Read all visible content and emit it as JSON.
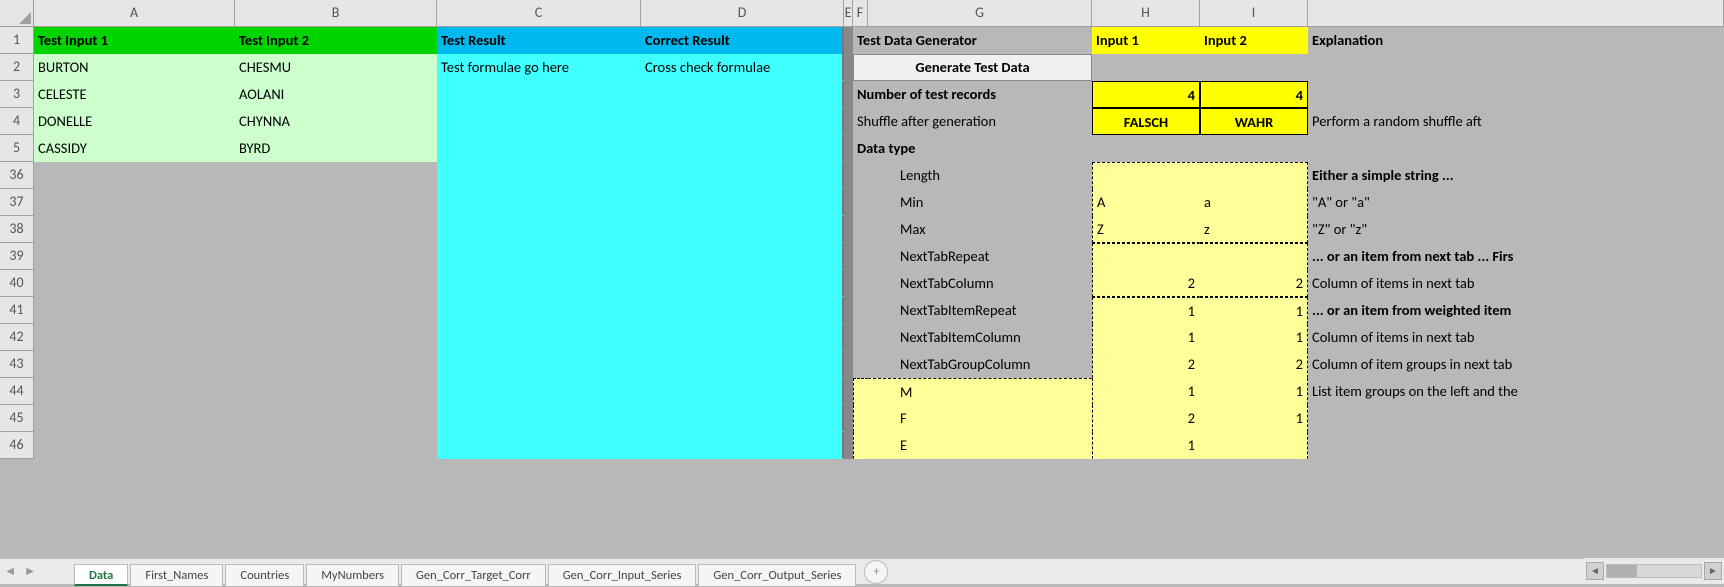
{
  "columns": [
    "A",
    "B",
    "C",
    "D",
    "E",
    "F",
    "G",
    "H",
    "I"
  ],
  "row_nums": [
    "1",
    "2",
    "3",
    "4",
    "5",
    "36",
    "37",
    "38",
    "39",
    "40",
    "41",
    "42",
    "43",
    "44",
    "45",
    "46"
  ],
  "headers": {
    "a1": "Test Input 1",
    "b1": "Test Input 2",
    "c1": "Test Result",
    "d1": "Correct Result",
    "fg1": "Test Data Generator",
    "h1": "Input 1",
    "i1": "Input 2",
    "j1": "Explanation"
  },
  "inputs": {
    "a2": "BURTON",
    "b2": "CHESMU",
    "a3": "CELESTE",
    "b3": "AOLANI",
    "a4": "DONELLE",
    "b4": "CHYNNA",
    "a5": "CASSIDY",
    "b5": "BYRD"
  },
  "results": {
    "c2": "Test formulae go here",
    "d2": "Cross check formulae"
  },
  "gen": {
    "btn": "Generate Test Data",
    "num_label": "Number of test records",
    "num_h": "4",
    "num_i": "4",
    "shuffle_label": "Shuffle after generation",
    "shuffle_h": "FALSCH",
    "shuffle_i": "WAHR",
    "shuffle_exp": "Perform a random shuffle aft",
    "dtype": "Data type",
    "length": "Length",
    "min": "Min",
    "min_h": "A",
    "min_i": "a",
    "min_exp": "\"A\" or \"a\"",
    "max": "Max",
    "max_h": "Z",
    "max_i": "z",
    "max_exp": "\"Z\" or \"z\"",
    "ntr": "NextTabRepeat",
    "ntr_exp": "... or an item from next tab ... Firs",
    "ntc": "NextTabColumn",
    "ntc_h": "2",
    "ntc_i": "2",
    "ntc_exp": "Column of items in next tab",
    "ntir": "NextTabItemRepeat",
    "ntir_h": "1",
    "ntir_i": "1",
    "ntir_exp": "... or an item from weighted item ",
    "ntic": "NextTabItemColumn",
    "ntic_h": "1",
    "ntic_i": "1",
    "ntic_exp": "Column of items in next tab",
    "ntgc": "NextTabGroupColumn",
    "ntgc_h": "2",
    "ntgc_i": "2",
    "ntgc_exp": "Column of item groups in next tab",
    "m": "M",
    "m_h": "1",
    "m_i": "1",
    "m_exp": "List item groups on the left and the",
    "f": "F",
    "f_h": "2",
    "f_i": "1",
    "e": "E",
    "e_h": "1",
    "either": "Either a simple string ..."
  },
  "tabs": [
    "Data",
    "First_Names",
    "Countries",
    "MyNumbers",
    "Gen_Corr_Target_Corr",
    "Gen_Corr_Input_Series",
    "Gen_Corr_Output_Series"
  ]
}
